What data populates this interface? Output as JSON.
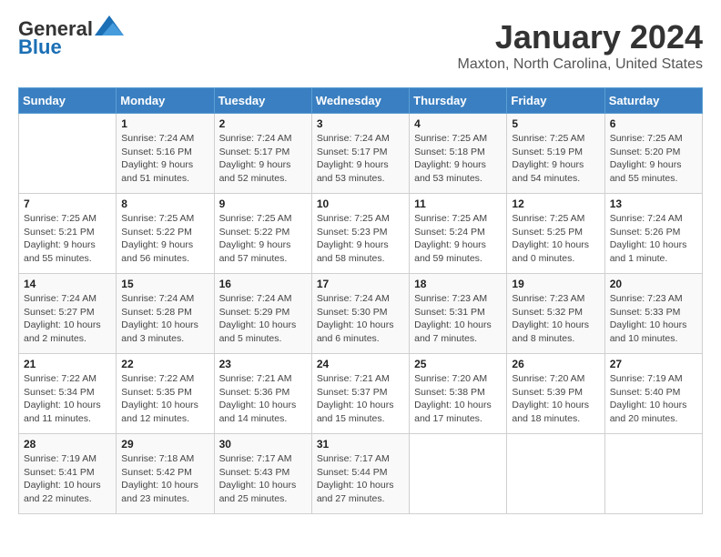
{
  "logo": {
    "line1": "General",
    "line2": "Blue"
  },
  "title": "January 2024",
  "subtitle": "Maxton, North Carolina, United States",
  "days_of_week": [
    "Sunday",
    "Monday",
    "Tuesday",
    "Wednesday",
    "Thursday",
    "Friday",
    "Saturday"
  ],
  "weeks": [
    [
      {
        "day": "",
        "info": ""
      },
      {
        "day": "1",
        "info": "Sunrise: 7:24 AM\nSunset: 5:16 PM\nDaylight: 9 hours\nand 51 minutes."
      },
      {
        "day": "2",
        "info": "Sunrise: 7:24 AM\nSunset: 5:17 PM\nDaylight: 9 hours\nand 52 minutes."
      },
      {
        "day": "3",
        "info": "Sunrise: 7:24 AM\nSunset: 5:17 PM\nDaylight: 9 hours\nand 53 minutes."
      },
      {
        "day": "4",
        "info": "Sunrise: 7:25 AM\nSunset: 5:18 PM\nDaylight: 9 hours\nand 53 minutes."
      },
      {
        "day": "5",
        "info": "Sunrise: 7:25 AM\nSunset: 5:19 PM\nDaylight: 9 hours\nand 54 minutes."
      },
      {
        "day": "6",
        "info": "Sunrise: 7:25 AM\nSunset: 5:20 PM\nDaylight: 9 hours\nand 55 minutes."
      }
    ],
    [
      {
        "day": "7",
        "info": "Sunrise: 7:25 AM\nSunset: 5:21 PM\nDaylight: 9 hours\nand 55 minutes."
      },
      {
        "day": "8",
        "info": "Sunrise: 7:25 AM\nSunset: 5:22 PM\nDaylight: 9 hours\nand 56 minutes."
      },
      {
        "day": "9",
        "info": "Sunrise: 7:25 AM\nSunset: 5:22 PM\nDaylight: 9 hours\nand 57 minutes."
      },
      {
        "day": "10",
        "info": "Sunrise: 7:25 AM\nSunset: 5:23 PM\nDaylight: 9 hours\nand 58 minutes."
      },
      {
        "day": "11",
        "info": "Sunrise: 7:25 AM\nSunset: 5:24 PM\nDaylight: 9 hours\nand 59 minutes."
      },
      {
        "day": "12",
        "info": "Sunrise: 7:25 AM\nSunset: 5:25 PM\nDaylight: 10 hours\nand 0 minutes."
      },
      {
        "day": "13",
        "info": "Sunrise: 7:24 AM\nSunset: 5:26 PM\nDaylight: 10 hours\nand 1 minute."
      }
    ],
    [
      {
        "day": "14",
        "info": "Sunrise: 7:24 AM\nSunset: 5:27 PM\nDaylight: 10 hours\nand 2 minutes."
      },
      {
        "day": "15",
        "info": "Sunrise: 7:24 AM\nSunset: 5:28 PM\nDaylight: 10 hours\nand 3 minutes."
      },
      {
        "day": "16",
        "info": "Sunrise: 7:24 AM\nSunset: 5:29 PM\nDaylight: 10 hours\nand 5 minutes."
      },
      {
        "day": "17",
        "info": "Sunrise: 7:24 AM\nSunset: 5:30 PM\nDaylight: 10 hours\nand 6 minutes."
      },
      {
        "day": "18",
        "info": "Sunrise: 7:23 AM\nSunset: 5:31 PM\nDaylight: 10 hours\nand 7 minutes."
      },
      {
        "day": "19",
        "info": "Sunrise: 7:23 AM\nSunset: 5:32 PM\nDaylight: 10 hours\nand 8 minutes."
      },
      {
        "day": "20",
        "info": "Sunrise: 7:23 AM\nSunset: 5:33 PM\nDaylight: 10 hours\nand 10 minutes."
      }
    ],
    [
      {
        "day": "21",
        "info": "Sunrise: 7:22 AM\nSunset: 5:34 PM\nDaylight: 10 hours\nand 11 minutes."
      },
      {
        "day": "22",
        "info": "Sunrise: 7:22 AM\nSunset: 5:35 PM\nDaylight: 10 hours\nand 12 minutes."
      },
      {
        "day": "23",
        "info": "Sunrise: 7:21 AM\nSunset: 5:36 PM\nDaylight: 10 hours\nand 14 minutes."
      },
      {
        "day": "24",
        "info": "Sunrise: 7:21 AM\nSunset: 5:37 PM\nDaylight: 10 hours\nand 15 minutes."
      },
      {
        "day": "25",
        "info": "Sunrise: 7:20 AM\nSunset: 5:38 PM\nDaylight: 10 hours\nand 17 minutes."
      },
      {
        "day": "26",
        "info": "Sunrise: 7:20 AM\nSunset: 5:39 PM\nDaylight: 10 hours\nand 18 minutes."
      },
      {
        "day": "27",
        "info": "Sunrise: 7:19 AM\nSunset: 5:40 PM\nDaylight: 10 hours\nand 20 minutes."
      }
    ],
    [
      {
        "day": "28",
        "info": "Sunrise: 7:19 AM\nSunset: 5:41 PM\nDaylight: 10 hours\nand 22 minutes."
      },
      {
        "day": "29",
        "info": "Sunrise: 7:18 AM\nSunset: 5:42 PM\nDaylight: 10 hours\nand 23 minutes."
      },
      {
        "day": "30",
        "info": "Sunrise: 7:17 AM\nSunset: 5:43 PM\nDaylight: 10 hours\nand 25 minutes."
      },
      {
        "day": "31",
        "info": "Sunrise: 7:17 AM\nSunset: 5:44 PM\nDaylight: 10 hours\nand 27 minutes."
      },
      {
        "day": "",
        "info": ""
      },
      {
        "day": "",
        "info": ""
      },
      {
        "day": "",
        "info": ""
      }
    ]
  ]
}
